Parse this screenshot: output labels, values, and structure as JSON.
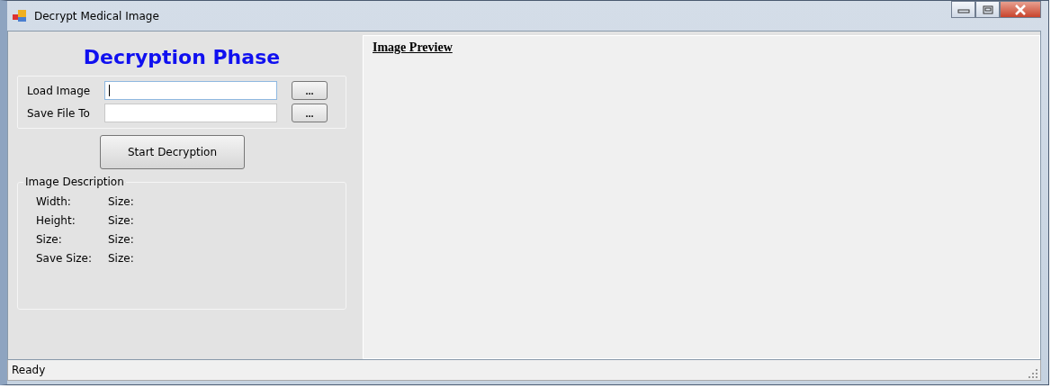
{
  "window": {
    "title": "Decrypt Medical Image"
  },
  "heading": "Decryption Phase",
  "fields": [
    {
      "label": "Load Image",
      "focused": true,
      "browse": "..."
    },
    {
      "label": "Save File To",
      "focused": false,
      "browse": "..."
    }
  ],
  "start_button": "Start Decryption",
  "description": {
    "title": "Image Description",
    "rows": [
      {
        "label": "Width:",
        "value": "Size:"
      },
      {
        "label": "Height:",
        "value": "Size:"
      },
      {
        "label": "Size:",
        "value": "Size:"
      },
      {
        "label": "Save Size:",
        "value": "Size:"
      }
    ]
  },
  "preview": {
    "title": "Image Preview"
  },
  "status_bar": "Ready"
}
